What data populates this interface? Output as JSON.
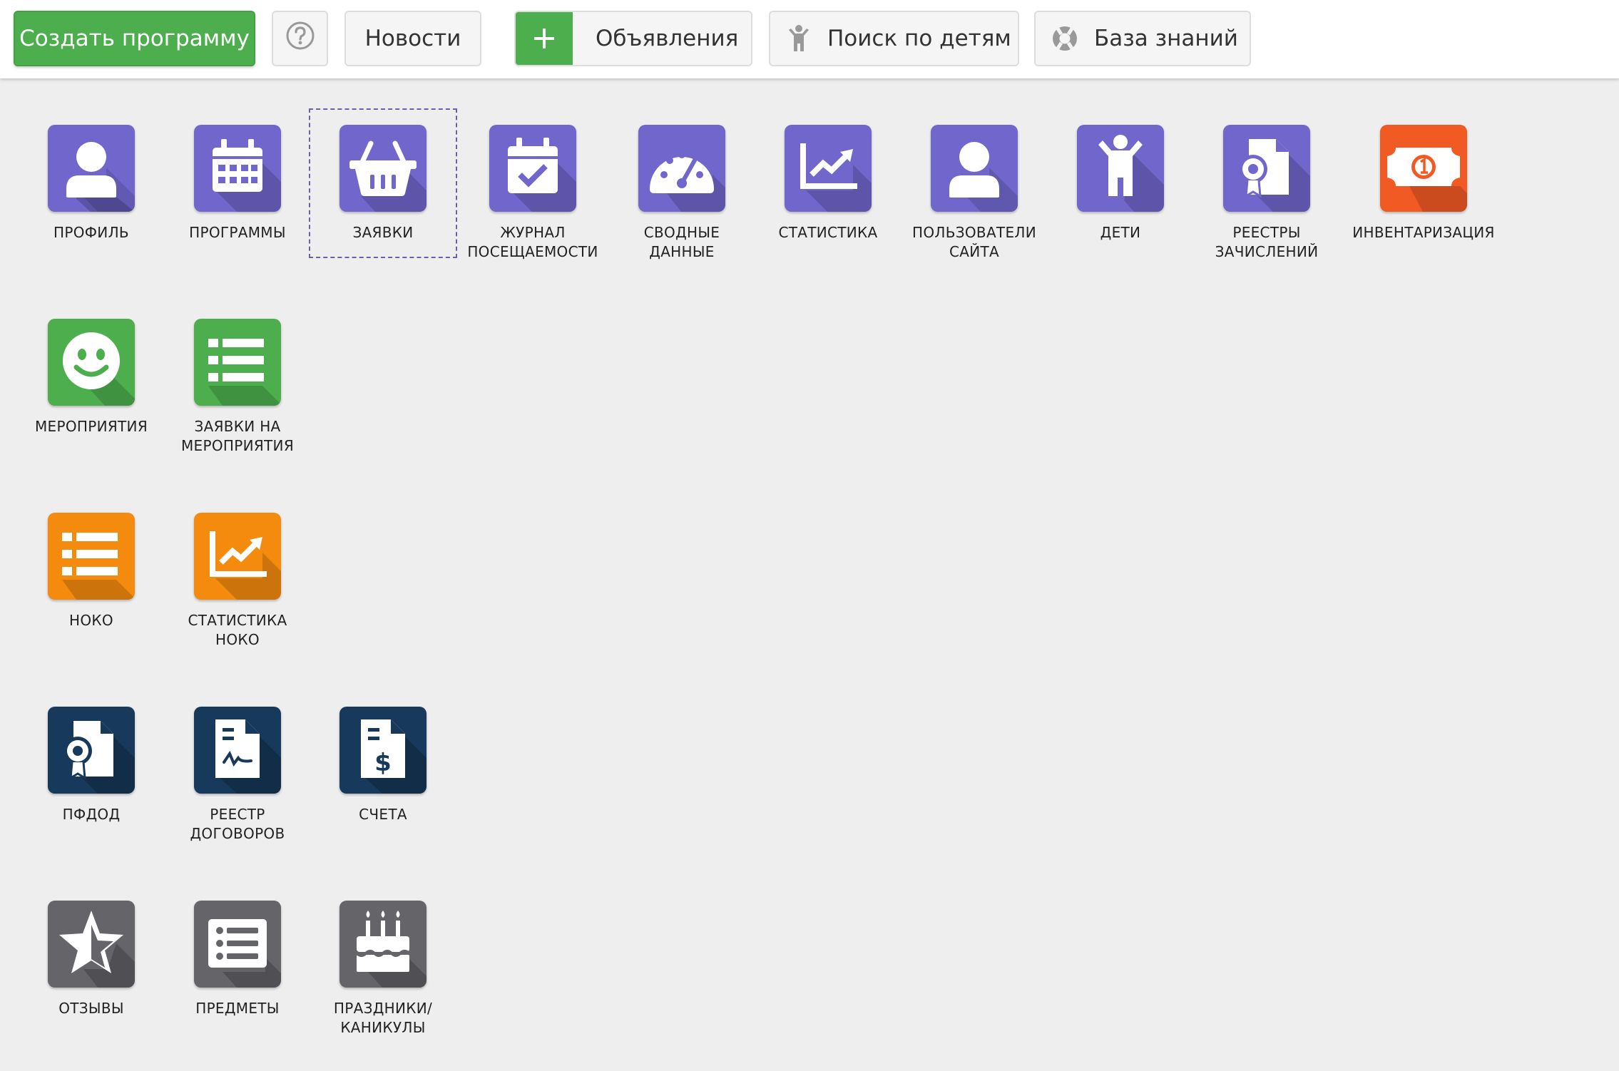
{
  "toolbar": {
    "create_label": "Создать программу",
    "help_icon": "question-circle-icon",
    "news_label": "Новости",
    "ads_label": "Объявления",
    "ads_icon": "plus-icon",
    "kids_label": "Поиск по детям",
    "kids_icon": "child-icon",
    "kb_label": "База знаний",
    "kb_icon": "lifebuoy-icon"
  },
  "colors": {
    "purple": "#7066cb",
    "green": "#4cae4c",
    "orange": "#f48a0e",
    "red": "#f25a24",
    "navy": "#173a5c",
    "gray": "#646469"
  },
  "tiles": {
    "profile": {
      "label": "ПРОФИЛЬ",
      "icon": "user-icon"
    },
    "programs": {
      "label": "ПРОГРАММЫ",
      "icon": "calendar-icon"
    },
    "applications": {
      "label": "ЗАЯВКИ",
      "icon": "basket-icon"
    },
    "attendance": {
      "label": "ЖУРНАЛ\nПОСЕЩАЕМОСТИ",
      "icon": "calendar-check-icon"
    },
    "summary": {
      "label": "СВОДНЫЕ\nДАННЫЕ",
      "icon": "gauge-icon"
    },
    "statistics": {
      "label": "СТАТИСТИКА",
      "icon": "line-chart-icon"
    },
    "site_users": {
      "label": "ПОЛЬЗОВАТЕЛИ\nСАЙТА",
      "icon": "user-icon"
    },
    "children": {
      "label": "ДЕТИ",
      "icon": "child-icon"
    },
    "enrollment_registers": {
      "label": "РЕЕСТРЫ\nЗАЧИСЛЕНИЙ",
      "icon": "certificate-icon"
    },
    "inventory": {
      "label": "ИНВЕНТАРИЗАЦИЯ",
      "icon": "money-icon"
    },
    "events": {
      "label": "МЕРОПРИЯТИЯ",
      "icon": "smile-icon"
    },
    "event_applications": {
      "label": "ЗАЯВКИ НА\nМЕРОПРИЯТИЯ",
      "icon": "list-icon"
    },
    "noko": {
      "label": "НОКО",
      "icon": "list-icon"
    },
    "noko_statistics": {
      "label": "СТАТИСТИКА\nНОКО",
      "icon": "line-chart-icon"
    },
    "pfdod": {
      "label": "ПФДОД",
      "icon": "certificate-icon"
    },
    "contracts_register": {
      "label": "РЕЕСТР\nДОГОВОРОВ",
      "icon": "contract-icon"
    },
    "invoices": {
      "label": "СЧЕТА",
      "icon": "invoice-icon"
    },
    "reviews": {
      "label": "ОТЗЫВЫ",
      "icon": "star-half-icon"
    },
    "subjects": {
      "label": "ПРЕДМЕТЫ",
      "icon": "list-alt-icon"
    },
    "holidays": {
      "label": "ПРАЗДНИКИ/\nКАНИКУЛЫ",
      "icon": "birthday-cake-icon"
    }
  }
}
